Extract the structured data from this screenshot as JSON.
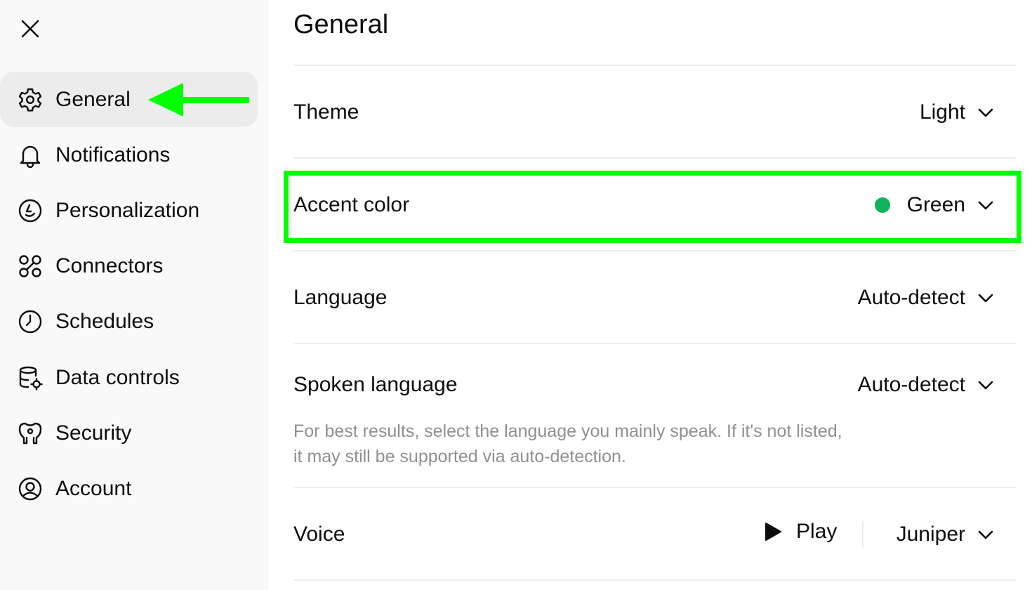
{
  "sidebar": {
    "close_label": "Close",
    "items": [
      {
        "label": "General",
        "icon": "gear-icon",
        "active": true
      },
      {
        "label": "Notifications",
        "icon": "bell-icon"
      },
      {
        "label": "Personalization",
        "icon": "personalization-icon"
      },
      {
        "label": "Connectors",
        "icon": "connectors-icon"
      },
      {
        "label": "Schedules",
        "icon": "clock-icon"
      },
      {
        "label": "Data controls",
        "icon": "database-gear-icon"
      },
      {
        "label": "Security",
        "icon": "shield-icon"
      },
      {
        "label": "Account",
        "icon": "account-icon"
      }
    ]
  },
  "main": {
    "title": "General",
    "theme": {
      "label": "Theme",
      "value": "Light"
    },
    "accent": {
      "label": "Accent color",
      "value": "Green",
      "color": "#10b35a"
    },
    "language": {
      "label": "Language",
      "value": "Auto-detect"
    },
    "spoken": {
      "label": "Spoken language",
      "value": "Auto-detect",
      "help_line1": "For best results, select the language you mainly speak. If it's not listed,",
      "help_line2": "it may still be supported via auto-detection."
    },
    "voice": {
      "label": "Voice",
      "play_label": "Play",
      "value": "Juniper"
    }
  },
  "colors": {
    "annotation": "#00ff00",
    "sidebar_bg": "#f9f9f9",
    "active_bg": "#ececec"
  }
}
